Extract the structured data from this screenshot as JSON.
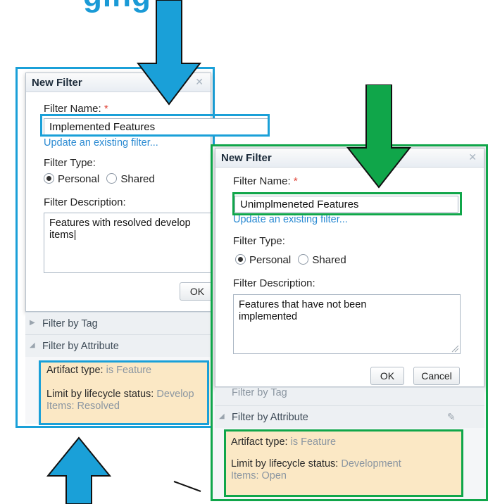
{
  "left_dialog": {
    "title": "New Filter",
    "filter_name_label": "Filter Name:",
    "required_mark": "*",
    "filter_name_value": "Implemented Features",
    "update_link": "Update an existing filter...",
    "filter_type_label": "Filter Type:",
    "personal_label": "Personal",
    "shared_label": "Shared",
    "filter_type_selected": "Personal",
    "description_label": "Filter Description:",
    "description_value": "Features with resolved develop\nitems|",
    "ok_label": "OK",
    "sections": {
      "tag": "Filter by Tag",
      "attribute": "Filter by Attribute"
    },
    "artifact_key": "Artifact type:",
    "artifact_val": "is Feature",
    "lifecycle_key": "Limit by lifecycle status:",
    "lifecycle_val": "Develop",
    "lifecycle_val2": "Items: Resolved"
  },
  "right_dialog": {
    "title": "New Filter",
    "filter_name_label": "Filter Name:",
    "required_mark": "*",
    "filter_name_value": "Unimplmeneted Features",
    "update_link": "Update an existing filter...",
    "filter_type_label": "Filter Type:",
    "personal_label": "Personal",
    "shared_label": "Shared",
    "filter_type_selected": "Personal",
    "description_label": "Filter Description:",
    "description_value": "Features that have not been\nimplemented",
    "ok_label": "OK",
    "cancel_label": "Cancel",
    "sections": {
      "tag_partial": "Filter by Tag",
      "attribute": "Filter by Attribute"
    },
    "artifact_key": "Artifact type:",
    "artifact_val": "is Feature",
    "lifecycle_key": "Limit by lifecycle status:",
    "lifecycle_val": "Development",
    "lifecycle_val2": "Items: Open"
  },
  "colors": {
    "blue_highlight": "#1aa0d8",
    "green_highlight": "#10a64a",
    "attr_bg": "#fbe8c5",
    "link": "#2a8ad2"
  },
  "icons": [
    "close-icon",
    "arrow-down-icon",
    "arrow-up-icon",
    "eraser-icon",
    "triangle-right-icon",
    "triangle-down-icon",
    "resize-grip-icon"
  ]
}
